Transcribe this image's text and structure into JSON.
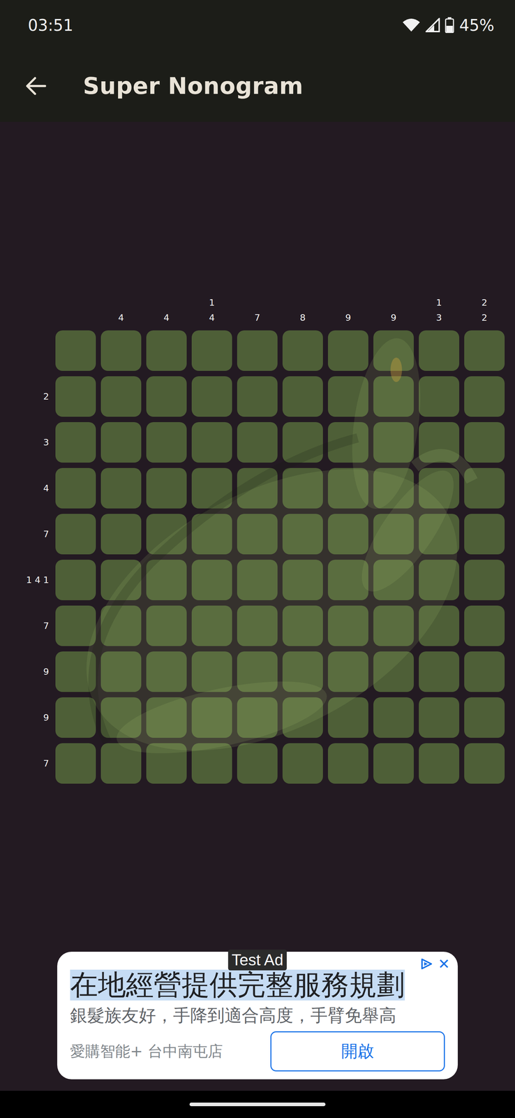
{
  "status_bar": {
    "time": "03:51",
    "battery": "45%"
  },
  "app_bar": {
    "title": "Super Nonogram"
  },
  "puzzle": {
    "column_clues": [
      [],
      [
        "4"
      ],
      [
        "4"
      ],
      [
        "1",
        "4"
      ],
      [
        "7"
      ],
      [
        "8"
      ],
      [
        "9"
      ],
      [
        "9"
      ],
      [
        "1",
        "3"
      ],
      [
        "2",
        "2"
      ]
    ],
    "rows": [
      {
        "clue": [],
        "cells": [
          false,
          false,
          false,
          false,
          false,
          false,
          false,
          false,
          false,
          false
        ]
      },
      {
        "clue": [
          "2"
        ],
        "cells": [
          false,
          false,
          false,
          false,
          false,
          false,
          false,
          false,
          false,
          false
        ]
      },
      {
        "clue": [
          "3"
        ],
        "cells": [
          false,
          false,
          false,
          false,
          false,
          false,
          false,
          false,
          false,
          false
        ]
      },
      {
        "clue": [
          "4"
        ],
        "cells": [
          false,
          false,
          false,
          false,
          false,
          false,
          false,
          false,
          false,
          false
        ]
      },
      {
        "clue": [
          "7"
        ],
        "cells": [
          false,
          false,
          false,
          false,
          false,
          false,
          false,
          false,
          false,
          false
        ]
      },
      {
        "clue": [
          "1",
          "4",
          "1"
        ],
        "cells": [
          false,
          false,
          false,
          false,
          false,
          false,
          false,
          false,
          false,
          false
        ]
      },
      {
        "clue": [
          "7"
        ],
        "cells": [
          false,
          false,
          false,
          false,
          false,
          false,
          false,
          false,
          false,
          false
        ]
      },
      {
        "clue": [
          "9"
        ],
        "cells": [
          false,
          false,
          false,
          false,
          false,
          false,
          false,
          false,
          false,
          false
        ]
      },
      {
        "clue": [
          "9"
        ],
        "cells": [
          false,
          false,
          false,
          false,
          false,
          false,
          false,
          false,
          false,
          false
        ]
      },
      {
        "clue": [
          "7"
        ],
        "cells": [
          false,
          false,
          false,
          false,
          false,
          false,
          false,
          false,
          false,
          false
        ]
      }
    ]
  },
  "ad": {
    "label": "Test Ad",
    "close": "✕",
    "headline": "在地經營提供完整服務規劃",
    "body": "銀髮族友好，手降到適合高度，手臂免舉高",
    "advertiser": "愛購智能+ 台中南屯店",
    "button": "開啟"
  }
}
